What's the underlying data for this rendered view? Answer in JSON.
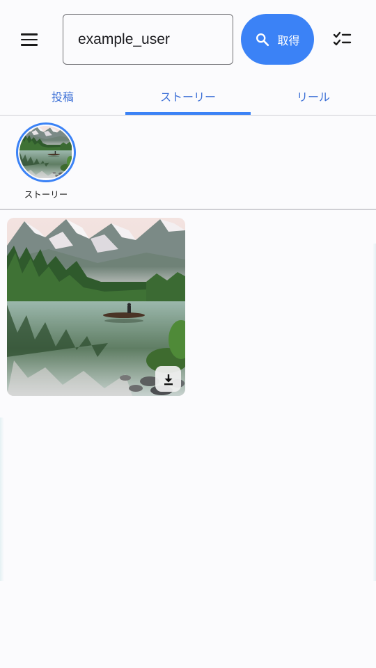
{
  "topbar": {
    "menu_icon": "hamburger-menu-icon",
    "search_value": "example_user",
    "search_placeholder": "",
    "fetch_label": "取得",
    "fetch_icon": "search-icon",
    "checklist_icon": "checklist-icon"
  },
  "tabs": [
    {
      "label": "投稿",
      "active": false
    },
    {
      "label": "ストーリー",
      "active": true
    },
    {
      "label": "リール",
      "active": false
    }
  ],
  "highlights": [
    {
      "label": "ストーリー"
    }
  ],
  "media": [
    {
      "type": "image",
      "download_icon": "download-icon"
    }
  ],
  "colors": {
    "accent": "#3b82f6",
    "tab_text": "#3b6fd6",
    "background": "#fbfbfd"
  }
}
